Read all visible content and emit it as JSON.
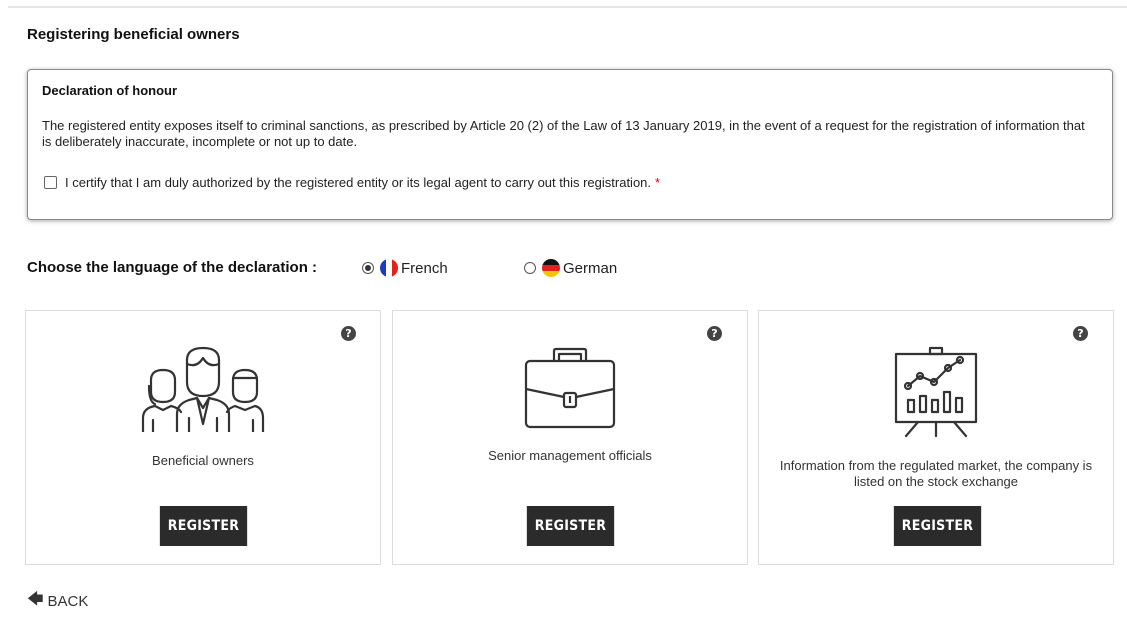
{
  "page_title": "Registering beneficial owners",
  "declaration": {
    "title": "Declaration of honour",
    "text": "The registered entity exposes itself to criminal sanctions, as prescribed by Article 20 (2) of the Law of 13 January 2019, in the event of a request for the registration of information that is deliberately inaccurate, incomplete or not up to date.",
    "certify_label": "I certify that I am duly authorized by the registered entity or its legal agent to carry out this registration.",
    "required_mark": "*",
    "certify_checked": false
  },
  "language": {
    "label": "Choose the language of the declaration :",
    "options": [
      {
        "label": "French",
        "selected": true,
        "flag": "france-flag-icon"
      },
      {
        "label": "German",
        "selected": false,
        "flag": "germany-flag-icon"
      }
    ]
  },
  "cards": [
    {
      "label": "Beneficial owners",
      "button": "REGISTER",
      "icon": "people-group-icon",
      "help": "?"
    },
    {
      "label": "Senior management officials",
      "button": "REGISTER",
      "icon": "briefcase-icon",
      "help": "?"
    },
    {
      "label": "Information from the regulated market, the company is listed on the stock exchange",
      "button": "REGISTER",
      "icon": "chart-presentation-icon",
      "help": "?"
    }
  ],
  "back_label": "BACK",
  "colors": {
    "button_bg": "#2b2b2b",
    "required": "#d0021b",
    "help_icon": "#444444"
  }
}
